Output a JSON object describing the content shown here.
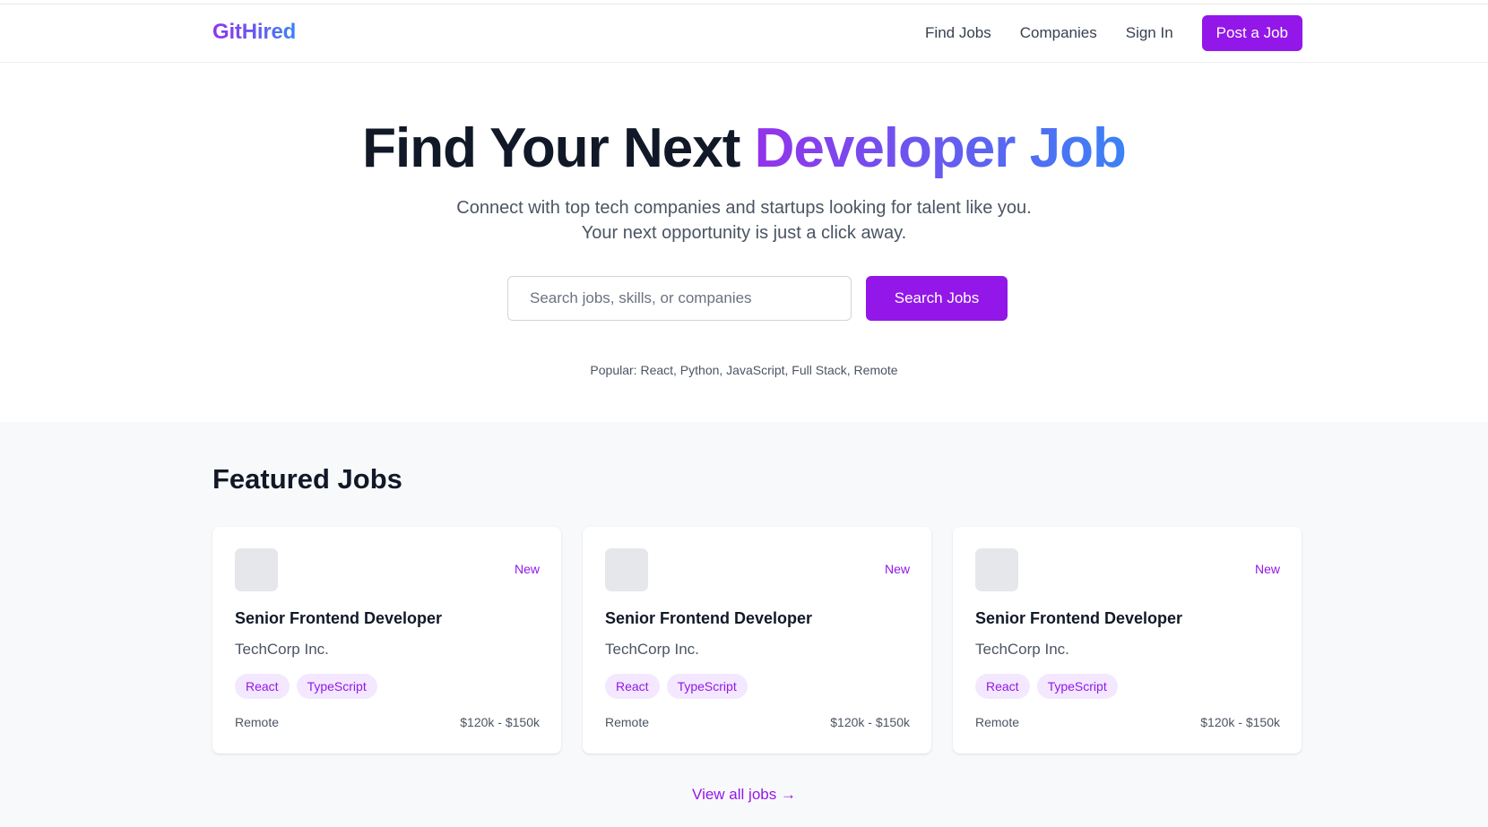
{
  "brand": {
    "logo": "GitHired"
  },
  "nav": {
    "items": [
      {
        "label": "Find Jobs"
      },
      {
        "label": "Companies"
      },
      {
        "label": "Sign In"
      }
    ],
    "cta": "Post a Job"
  },
  "hero": {
    "title_main": "Find Your Next ",
    "title_accent": "Developer Job",
    "subtitle": "Connect with top tech companies and startups looking for talent like you. Your next opportunity is just a click away.",
    "search_placeholder": "Search jobs, skills, or companies",
    "search_value": "",
    "search_button": "Search Jobs",
    "popular": "Popular: React, Python, JavaScript, Full Stack, Remote"
  },
  "featured": {
    "heading": "Featured Jobs",
    "jobs": [
      {
        "badge": "New",
        "title": "Senior Frontend Developer",
        "company": "TechCorp Inc.",
        "tags": [
          "React",
          "TypeScript"
        ],
        "location": "Remote",
        "salary": "$120k - $150k"
      },
      {
        "badge": "New",
        "title": "Senior Frontend Developer",
        "company": "TechCorp Inc.",
        "tags": [
          "React",
          "TypeScript"
        ],
        "location": "Remote",
        "salary": "$120k - $150k"
      },
      {
        "badge": "New",
        "title": "Senior Frontend Developer",
        "company": "TechCorp Inc.",
        "tags": [
          "React",
          "TypeScript"
        ],
        "location": "Remote",
        "salary": "$120k - $150k"
      }
    ],
    "view_all": "View all jobs →"
  },
  "colors": {
    "accent": "#9317e8",
    "gradient_start": "#9333ea",
    "gradient_end": "#3b82f6",
    "tag_bg": "#f3e8ff",
    "section_bg": "#f8f9fb"
  }
}
